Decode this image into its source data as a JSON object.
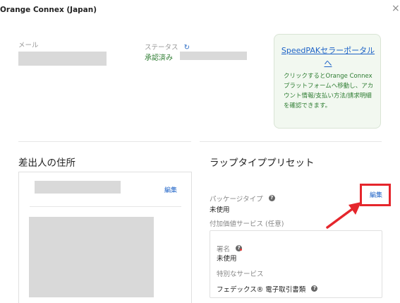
{
  "window": {
    "title": "Orange Connex (Japan)",
    "close_symbol": "×"
  },
  "account": {
    "email_label": "メール",
    "status_label": "ステータス",
    "status_value": "承認済み"
  },
  "portal_card": {
    "link_text": "SpeedPAKセラーポータルへ",
    "description": "クリックするとOrange Connexプラットフォームへ移動し、アカウント情報/支払い方法/請求明細を確認できます。"
  },
  "sender": {
    "heading": "差出人の住所",
    "edit_label": "編集"
  },
  "wrap_preset": {
    "heading": "ラップタイププリセット",
    "package_type_label": "パッケージタイプ",
    "package_type_value": "未使用",
    "edit_label": "編集",
    "value_added_label": "付加価値サービス (任意)",
    "signature_label": "署名",
    "signature_value": "未使用",
    "special_service_label": "特別なサービス",
    "special_service_value": "フェデックス® 電子取引書類"
  },
  "colors": {
    "accent": "#1e63c7",
    "success": "#2e7d32",
    "annotation": "#e5262c"
  },
  "icons": {
    "close": "close-icon",
    "refresh": "refresh-icon",
    "help": "help-icon",
    "arrow": "red-arrow-annotation"
  }
}
